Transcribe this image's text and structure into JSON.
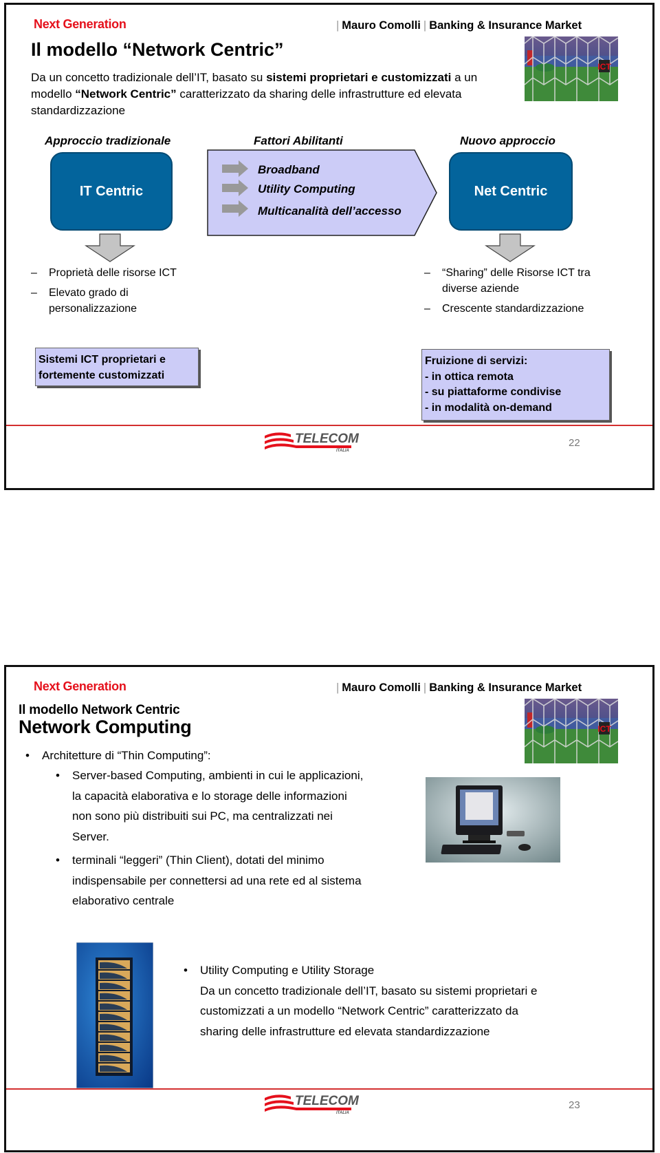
{
  "slides": [
    {
      "section": "Next Generation",
      "header": {
        "author": "Mauro Comolli",
        "market": "Banking & Insurance Market",
        "separator": "|"
      },
      "title": "Il modello “Network Centric”",
      "lead": {
        "part1": "Da  un concetto tradizionale dell’IT, basato su ",
        "bold1": "sistemi proprietari e customizzati",
        "part2": " a un modello ",
        "bold2": "“Network Centric”",
        "part3": " caratterizzato da sharing delle infrastrutture ed elevata standardizzazione"
      },
      "columns": {
        "left_heading": "Approccio tradizionale",
        "middle_heading": "Fattori Abilitanti",
        "right_heading": "Nuovo approccio"
      },
      "left_box": "IT Centric",
      "right_box": "Net Centric",
      "enablers": [
        "Broadband",
        "Utility Computing",
        "Multicanalità dell’accesso"
      ],
      "left_list": [
        "Proprietà delle risorse ICT",
        "Elevato grado di personalizzazione"
      ],
      "right_list": [
        "“Sharing” delle Risorse ICT tra diverse aziende",
        "Crescente standardizzazione"
      ],
      "left_summary": [
        "Sistemi ICT proprietari e",
        "fortemente customizzati"
      ],
      "right_summary": [
        "Fruizione di servizi:",
        "-  in ottica remota",
        "-  su piattaforme condivise",
        "-  in modalità on-demand"
      ],
      "footer": {
        "logo": "TELECOM",
        "logo_sub": "ITALIA",
        "page": "22"
      },
      "photo_badge": "ICT"
    },
    {
      "section": "Next Generation",
      "header": {
        "author": "Mauro Comolli",
        "market": "Banking & Insurance Market",
        "separator": "|"
      },
      "subtitle": "Il modello Network Centric",
      "title": "Network Computing",
      "bullets": {
        "main": "Architetture di “Thin Computing”:",
        "sub": [
          [
            "Server-based Computing, ambienti in cui le applicazioni,",
            "la capacità elaborativa e lo storage delle informazioni",
            "non sono più distribuiti sui PC, ma centralizzati nei",
            "Server."
          ],
          [
            "terminali “leggeri” (Thin Client), dotati del minimo",
            "indispensabile per connettersi ad una rete ed al sistema",
            "elaborativo centrale"
          ]
        ],
        "utility": [
          "Utility Computing e Utility Storage",
          "Da  un concetto tradizionale dell’IT, basato su sistemi proprietari e",
          "customizzati a un modello “Network Centric” caratterizzato da",
          "sharing delle infrastrutture ed elevata standardizzazione"
        ]
      },
      "bullet_glyph": "•",
      "footer": {
        "logo": "TELECOM",
        "logo_sub": "ITALIA",
        "page": "23"
      },
      "photo_badge": "ICT"
    }
  ],
  "colors": {
    "accent_red": "#e5101b",
    "box_blue": "#03649c",
    "lavender": "#ccccf7",
    "footer_line": "#d32f2f"
  }
}
